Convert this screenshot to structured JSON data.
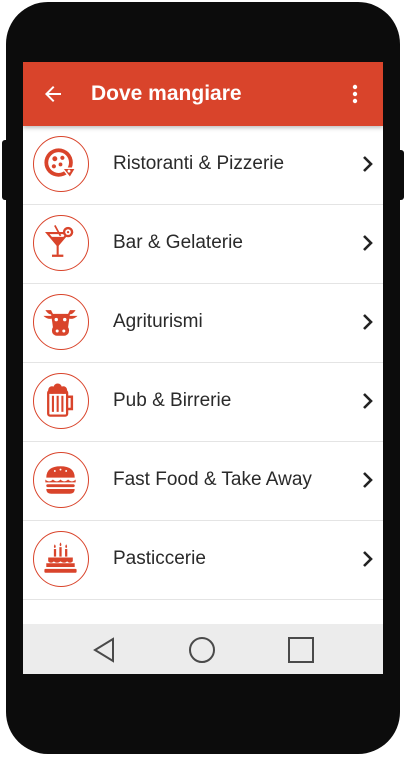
{
  "colors": {
    "accent": "#d9442b",
    "text": "#2a2a2a",
    "divider": "#e4e4e4",
    "navbar": "#ececec"
  },
  "appbar": {
    "title": "Dove mangiare",
    "back_icon": "arrow-left-icon",
    "menu_icon": "more-vertical-icon"
  },
  "categories": [
    {
      "label": "Ristoranti & Pizzerie",
      "icon": "pizza-icon"
    },
    {
      "label": "Bar & Gelaterie",
      "icon": "cocktail-glass-icon"
    },
    {
      "label": "Agriturismi",
      "icon": "cow-head-icon"
    },
    {
      "label": "Pub & Birrerie",
      "icon": "beer-mug-icon"
    },
    {
      "label": "Fast Food & Take Away",
      "icon": "burger-icon"
    },
    {
      "label": "Pasticcerie",
      "icon": "cake-icon"
    }
  ],
  "navbar": {
    "back": "triangle-back-icon",
    "home": "circle-home-icon",
    "recents": "square-recents-icon"
  }
}
